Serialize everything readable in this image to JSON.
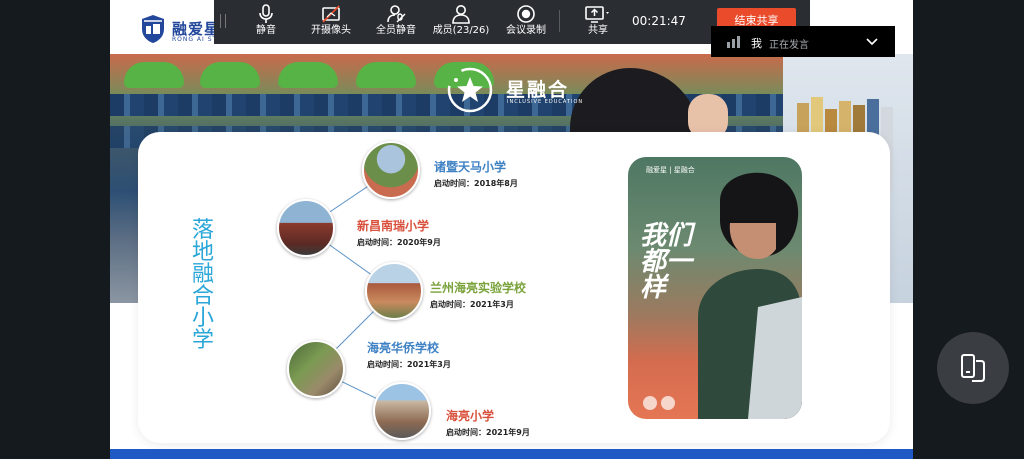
{
  "toolbar": {
    "buttons": [
      {
        "id": "mute",
        "label": "静音",
        "icon": "microphone-icon"
      },
      {
        "id": "camera",
        "label": "开摄像头",
        "icon": "camera-off-icon"
      },
      {
        "id": "mute_all",
        "label": "全员静音",
        "icon": "mute-all-icon"
      },
      {
        "id": "members",
        "label": "成员(23/26)",
        "icon": "members-icon"
      },
      {
        "id": "record",
        "label": "会议录制",
        "icon": "record-icon"
      },
      {
        "id": "share",
        "label": "共享",
        "icon": "share-screen-icon"
      }
    ],
    "timer": "00:21:47",
    "end_share_label": "结束共享"
  },
  "speaker": {
    "me_label": "我",
    "status": "正在发言"
  },
  "slide": {
    "brand_name": "融爱星",
    "brand_sub": "RONG AI STAR",
    "sub_brand_name": "星融合",
    "sub_brand_en": "INCLUSIVE EDUCATION",
    "card_title": "落地融合小学",
    "schools": [
      {
        "name": "诸暨天马小学",
        "date": "启动时间：2018年8月",
        "color": "#3f82c4"
      },
      {
        "name": "新昌南瑞小学",
        "date": "启动时间：2020年9月",
        "color": "#d9503c"
      },
      {
        "name": "兰州海亮实验学校",
        "date": "启动时间：2021年3月",
        "color": "#7ba33c"
      },
      {
        "name": "海亮华侨学校",
        "date": "启动时间：2021年3月",
        "color": "#3f82c4"
      },
      {
        "name": "海亮小学",
        "date": "启动时间：2021年9月",
        "color": "#d9503c"
      }
    ],
    "poster": {
      "brand": "融爱星 | 星融合",
      "slogan": "我们都一样"
    }
  },
  "colors": {
    "toolbar_bg": "#2a2e33",
    "end_share": "#e94b2b",
    "title_blue": "#2aa6d8",
    "brand_blue": "#23479b"
  }
}
